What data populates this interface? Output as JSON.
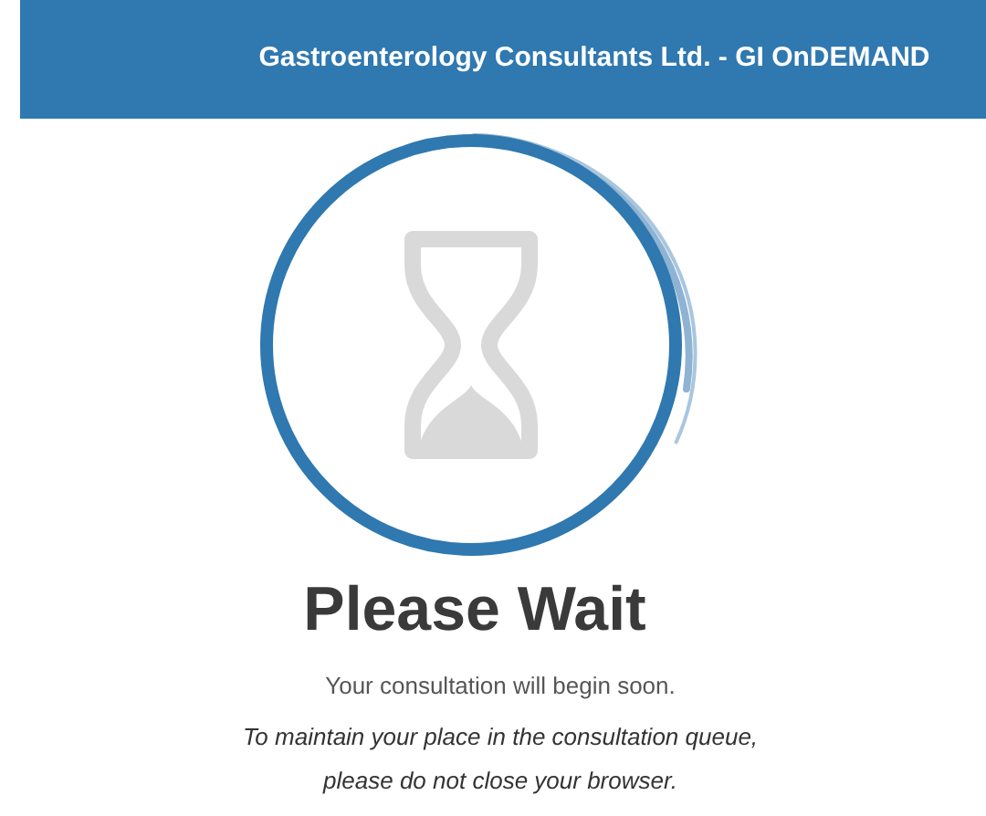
{
  "header": {
    "title": "Gastroenterology Consultants Ltd. - GI OnDEMAND"
  },
  "heading": "Please Wait",
  "message": "Your consultation will begin soon.",
  "notice": [
    "To maintain your place in the consultation queue,",
    "please do not close your browser."
  ]
}
